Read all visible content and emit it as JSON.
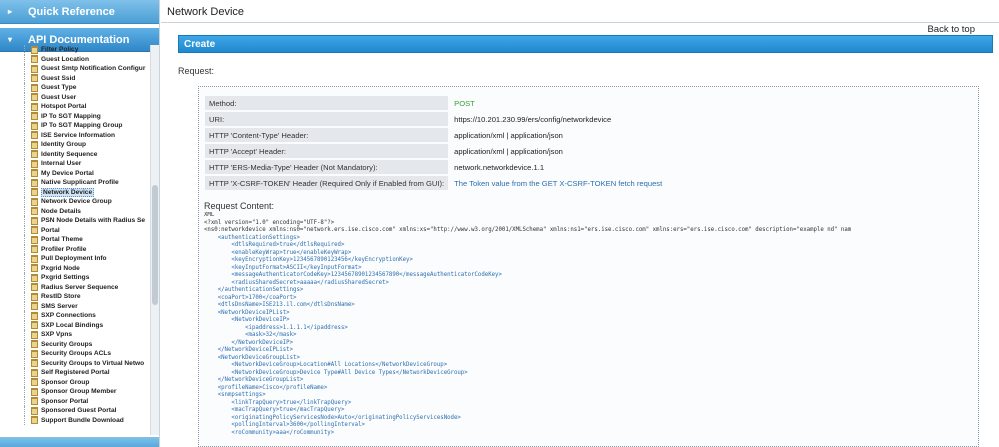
{
  "sidebar": {
    "quick_reference": "Quick Reference",
    "api_documentation": "API Documentation",
    "items": [
      "Filter Policy",
      "Guest Location",
      "Guest Smtp Notification Configur",
      "Guest Ssid",
      "Guest Type",
      "Guest User",
      "Hotspot Portal",
      "IP To SGT Mapping",
      "IP To SGT Mapping Group",
      "ISE Service Information",
      "Identity Group",
      "Identity Sequence",
      "Internal User",
      "My Device Portal",
      "Native Supplicant Profile",
      "Network Device",
      "Network Device Group",
      "Node Details",
      "PSN Node Details with Radius Se",
      "Portal",
      "Portal Theme",
      "Profiler Profile",
      "Pull Deployment Info",
      "Pxgrid Node",
      "Pxgrid Settings",
      "Radius Server Sequence",
      "RestID Store",
      "SMS Server",
      "SXP Connections",
      "SXP Local Bindings",
      "SXP Vpns",
      "Security Groups",
      "Security Groups ACLs",
      "Security Groups to Virtual Netwo",
      "Self Registered Portal",
      "Sponsor Group",
      "Sponsor Group Member",
      "Sponsor Portal",
      "Sponsored Guest Portal",
      "Support Bundle Download"
    ],
    "selected": "Network Device"
  },
  "main": {
    "page_title": "Network Device",
    "back_to_top": "Back to top",
    "create": "Create",
    "request_label": "Request:",
    "request_rows": [
      {
        "key": "Method:",
        "value": "POST",
        "style": "green"
      },
      {
        "key": "URI:",
        "value": "https://10.201.230.99/ers/config/networkdevice",
        "style": ""
      },
      {
        "key": "HTTP 'Content-Type' Header:",
        "value": "application/xml | application/json",
        "style": ""
      },
      {
        "key": "HTTP 'Accept' Header:",
        "value": "application/xml | application/json",
        "style": ""
      },
      {
        "key": "HTTP 'ERS-Media-Type' Header (Not Mandatory):",
        "value": "network.networkdevice.1.1",
        "style": ""
      },
      {
        "key": "HTTP 'X-CSRF-TOKEN' Header (Required Only if Enabled from GUI):",
        "value": "The Token value from the GET X-CSRF-TOKEN fetch request",
        "style": "blue"
      }
    ],
    "request_content_label": "Request Content:",
    "code_lines": [
      "XML",
      "<?xml version=\"1.0\" encoding=\"UTF-8\"?>",
      "<ns0:networkdevice xmlns:ns0=\"network.ers.ise.cisco.com\" xmlns:xs=\"http://www.w3.org/2001/XMLSchema\" xmlns:ns1=\"ers.ise.cisco.com\" xmlns:ers=\"ers.ise.cisco.com\" description=\"example nd\" nam",
      "    <authenticationSettings>",
      "        <dtlsRequired>true</dtlsRequired>",
      "        <enableKeyWrap>true</enableKeyWrap>",
      "        <keyEncryptionKey>1234567890123456</keyEncryptionKey>",
      "        <keyInputFormat>ASCII</keyInputFormat>",
      "        <messageAuthenticatorCodeKey>12345678901234567890</messageAuthenticatorCodeKey>",
      "        <radiusSharedSecret>aaaaa</radiusSharedSecret>",
      "    </authenticationSettings>",
      "    <coaPort>1700</coaPort>",
      "    <dtlsDnsName>ISE213.il.com</dtlsDnsName>",
      "    <NetworkDeviceIPList>",
      "        <NetworkDeviceIP>",
      "            <ipaddress>1.1.1.1</ipaddress>",
      "            <mask>32</mask>",
      "        </NetworkDeviceIP>",
      "    </NetworkDeviceIPList>",
      "    <NetworkDeviceGroupList>",
      "        <NetworkDeviceGroup>Location#All Locations</NetworkDeviceGroup>",
      "        <NetworkDeviceGroup>Device Type#All Device Types</NetworkDeviceGroup>",
      "    </NetworkDeviceGroupList>",
      "    <profileName>Cisco</profileName>",
      "    <snmpsettings>",
      "        <linkTrapQuery>true</linkTrapQuery>",
      "        <macTrapQuery>true</macTrapQuery>",
      "        <originatingPolicyServicesNode>Auto</originatingPolicyServicesNode>",
      "        <pollingInterval>3600</pollingInterval>",
      "        <roCommunity>aaa</roCommunity>"
    ]
  }
}
